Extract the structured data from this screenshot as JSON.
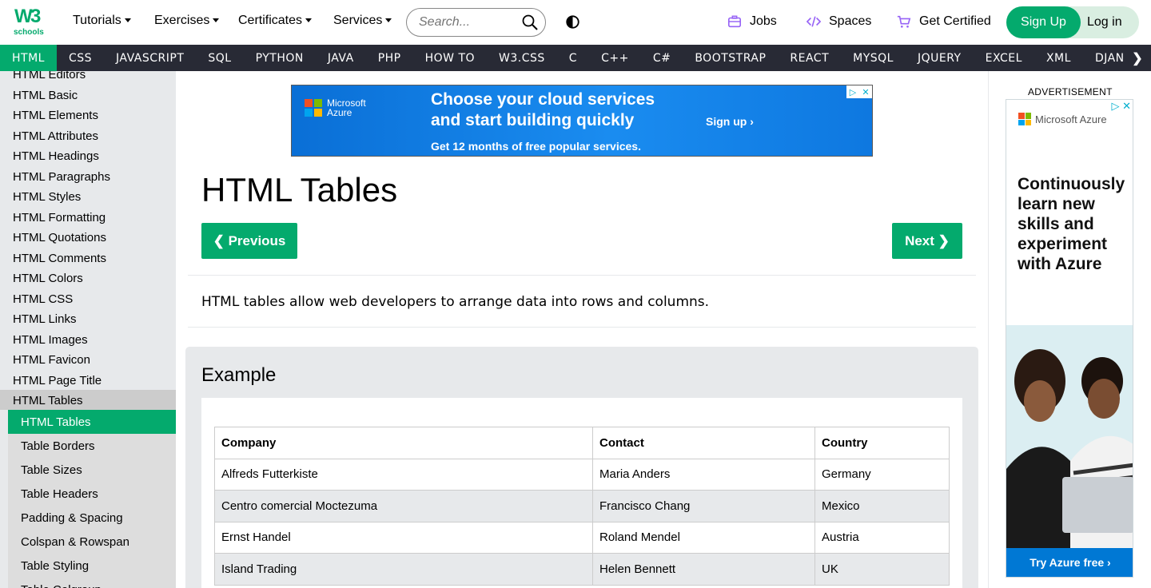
{
  "header": {
    "logo_main": "W",
    "logo_sup": "3",
    "logo_sub": "schools",
    "nav": [
      {
        "label": "Tutorials"
      },
      {
        "label": "Exercises"
      },
      {
        "label": "Certificates"
      },
      {
        "label": "Services"
      }
    ],
    "search_placeholder": "Search...",
    "links": {
      "jobs": "Jobs",
      "spaces": "Spaces",
      "get_certified": "Get Certified"
    },
    "signup": "Sign Up",
    "login": "Log in"
  },
  "langbar": {
    "items": [
      "HTML",
      "CSS",
      "JAVASCRIPT",
      "SQL",
      "PYTHON",
      "JAVA",
      "PHP",
      "HOW TO",
      "W3.CSS",
      "C",
      "C++",
      "C#",
      "BOOTSTRAP",
      "REACT",
      "MYSQL",
      "JQUERY",
      "EXCEL",
      "XML",
      "DJANGO"
    ],
    "active": "HTML"
  },
  "sidebar": {
    "items": [
      "HTML Editors",
      "HTML Basic",
      "HTML Elements",
      "HTML Attributes",
      "HTML Headings",
      "HTML Paragraphs",
      "HTML Styles",
      "HTML Formatting",
      "HTML Quotations",
      "HTML Comments",
      "HTML Colors",
      "HTML CSS",
      "HTML Links",
      "HTML Images",
      "HTML Favicon",
      "HTML Page Title",
      "HTML Tables"
    ],
    "sub_items": [
      "HTML Tables",
      "Table Borders",
      "Table Sizes",
      "Table Headers",
      "Padding & Spacing",
      "Colspan & Rowspan",
      "Table Styling",
      "Table Colgroup"
    ]
  },
  "ad_banner": {
    "brand_line1": "Microsoft",
    "brand_line2": "Azure",
    "headline_line1": "Choose your cloud services",
    "headline_line2": "and start building quickly",
    "cta": "Sign up ›",
    "sub": "Get 12 months of free popular services."
  },
  "main": {
    "title": "HTML Tables",
    "prev": "❮ Previous",
    "next": "Next ❯",
    "intro": "HTML tables allow web developers to arrange data into rows and columns.",
    "example_title": "Example",
    "table": {
      "headers": [
        "Company",
        "Contact",
        "Country"
      ],
      "rows": [
        [
          "Alfreds Futterkiste",
          "Maria Anders",
          "Germany"
        ],
        [
          "Centro comercial Moctezuma",
          "Francisco Chang",
          "Mexico"
        ],
        [
          "Ernst Handel",
          "Roland Mendel",
          "Austria"
        ],
        [
          "Island Trading",
          "Helen Bennett",
          "UK"
        ]
      ]
    }
  },
  "right_ad": {
    "label": "ADVERTISEMENT",
    "brand": "Microsoft Azure",
    "copy_lines": [
      "Continuously",
      "learn new",
      "skills and",
      "experiment",
      "with Azure"
    ],
    "cta": "Try Azure free ›"
  },
  "colors": {
    "accent": "#04AA6D",
    "dark_bar": "#282A35",
    "sidebar_bg": "#E7E9EB"
  }
}
